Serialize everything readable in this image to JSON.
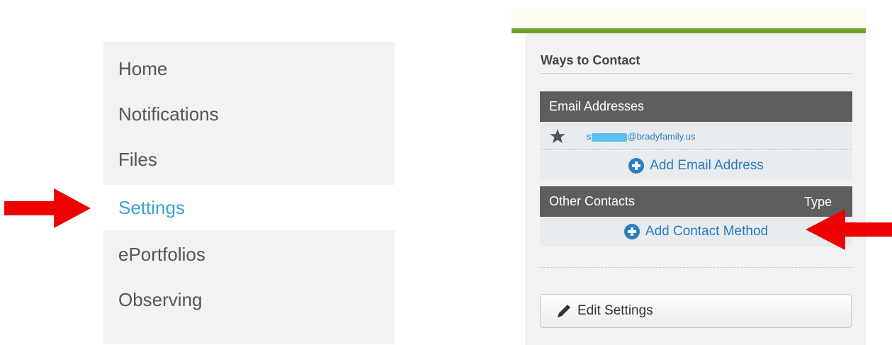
{
  "nav": {
    "items": [
      {
        "label": "Home",
        "active": false
      },
      {
        "label": "Notifications",
        "active": false
      },
      {
        "label": "Files",
        "active": false
      },
      {
        "label": "Settings",
        "active": true
      },
      {
        "label": "ePortfolios",
        "active": false
      },
      {
        "label": "Observing",
        "active": false
      }
    ]
  },
  "contact": {
    "title": "Ways to Contact",
    "email_header": "Email Addresses",
    "email_row": {
      "prefix": "s",
      "domain": "@bradyfamily.us",
      "icon": "star-icon"
    },
    "add_email_label": "Add Email Address",
    "other_header": "Other Contacts",
    "type_header": "Type",
    "add_contact_label": "Add Contact Method",
    "edit_settings_label": "Edit Settings"
  },
  "colors": {
    "accent_blue": "#2b7bbd",
    "nav_active": "#3da3d1",
    "green_bar": "#71a22e",
    "annotation_arrow": "#ee0000"
  },
  "annotations": {
    "arrows": [
      "arrow-right-icon",
      "arrow-left-icon"
    ]
  }
}
